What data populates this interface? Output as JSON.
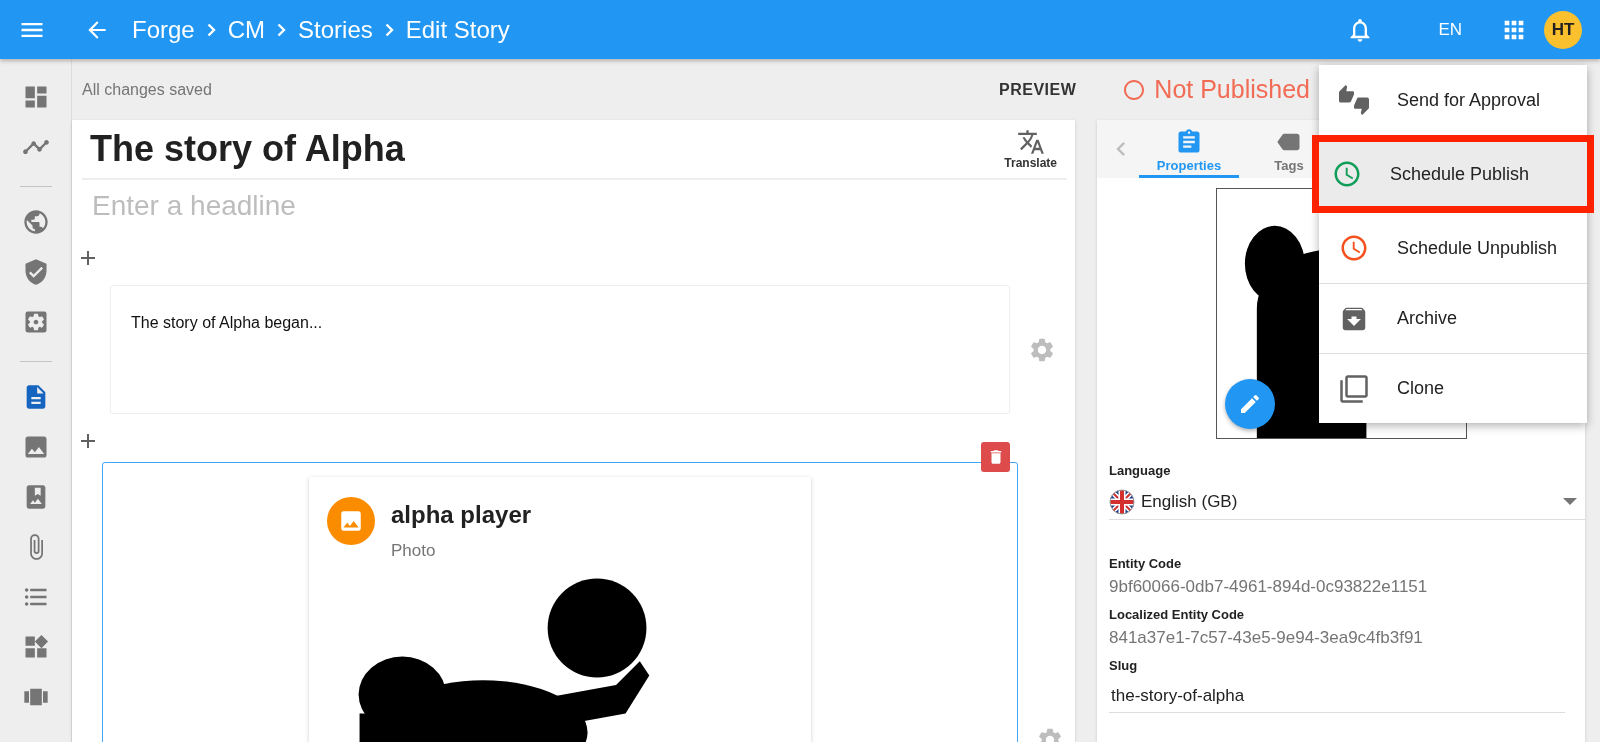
{
  "top_bar": {
    "breadcrumbs": [
      "Forge",
      "CM",
      "Stories",
      "Edit Story"
    ],
    "language": "EN",
    "avatar": "HT"
  },
  "sidebar": {
    "groups": [
      [
        {
          "selected": false
        },
        {
          "selected": false
        }
      ],
      [
        {
          "selected": false
        },
        {
          "selected": false
        },
        {
          "selected": false
        }
      ],
      [
        {
          "selected": true
        },
        {
          "selected": false
        },
        {
          "selected": false
        },
        {
          "selected": false
        },
        {
          "selected": false
        },
        {
          "selected": false
        },
        {
          "selected": false
        }
      ]
    ]
  },
  "status": {
    "save_state": "All changes saved",
    "preview": "PREVIEW",
    "publish_state": "Not Published"
  },
  "editor": {
    "title": "The story of Alpha",
    "translate": "Translate",
    "headline": {
      "placeholder": "Enter a headline"
    },
    "blocks": [
      {
        "kind": "text",
        "text": "The story of Alpha began...",
        "selected": false
      },
      {
        "kind": "media",
        "title": "alpha player",
        "subtitle": "Photo",
        "selected": true
      }
    ]
  },
  "properties_panel": {
    "tabs": [
      {
        "label": "Properties",
        "selected": true
      },
      {
        "label": "Tags",
        "selected": false
      }
    ],
    "fields": [
      {
        "kind": "select",
        "label": "Language",
        "value": "English (GB)"
      },
      {
        "kind": "readonly",
        "label": "Entity Code",
        "value": "9bf60066-0db7-4961-894d-0c93822e1151"
      },
      {
        "kind": "readonly",
        "label": "Localized Entity Code",
        "value": "841a37e1-7c57-43e5-9e94-3ea9c4fb3f91"
      },
      {
        "kind": "input",
        "label": "Slug",
        "value": "the-story-of-alpha"
      }
    ]
  },
  "actions_menu": {
    "items": [
      {
        "label": "Send for Approval",
        "selected": false,
        "highlighted": false,
        "divider_before": false,
        "color": "#616161"
      },
      {
        "label": "Schedule Publish",
        "selected": true,
        "highlighted": true,
        "divider_before": false,
        "color": "#0f9d58"
      },
      {
        "label": "Schedule Unpublish",
        "selected": false,
        "highlighted": false,
        "divider_before": false,
        "color": "#f4511e"
      },
      {
        "label": "Archive",
        "selected": false,
        "highlighted": false,
        "divider_before": true,
        "color": "#616161"
      },
      {
        "label": "Clone",
        "selected": false,
        "highlighted": false,
        "divider_before": true,
        "color": "#616161"
      }
    ]
  }
}
